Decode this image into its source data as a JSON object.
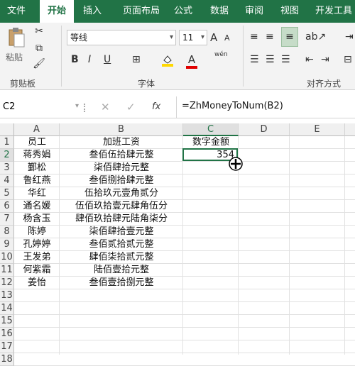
{
  "tabs": [
    "文件",
    "开始",
    "插入",
    "页面布局",
    "公式",
    "数据",
    "审阅",
    "视图",
    "开发工具"
  ],
  "ribbon": {
    "clipboard": {
      "paste_label": "粘贴",
      "group_label": "剪贴板"
    },
    "font": {
      "font_name": "等线",
      "font_size": "11",
      "group_label": "字体",
      "bold": "B",
      "italic": "I",
      "underline": "U",
      "grow": "A",
      "shrink": "A",
      "phonetic": "wén"
    },
    "alignment": {
      "group_label": "对齐方式"
    }
  },
  "formula_bar": {
    "name_box": "C2",
    "fx": "fx",
    "formula": "=ZhMoneyToNum(B2)"
  },
  "columns": [
    "A",
    "B",
    "C",
    "D",
    "E"
  ],
  "rows": [
    "1",
    "2",
    "3",
    "4",
    "5",
    "6",
    "7",
    "8",
    "9",
    "10",
    "11",
    "12",
    "13",
    "14",
    "15",
    "16",
    "17",
    "18"
  ],
  "data": [
    [
      "员工",
      "加班工资",
      "数字金额"
    ],
    [
      "蒋秀娟",
      "叁佰伍拾肆元整",
      "354"
    ],
    [
      "鄞松",
      "柒佰肆拾元整",
      ""
    ],
    [
      "鲁红燕",
      "叁佰捌拾肆元整",
      ""
    ],
    [
      "华红",
      "伍拾玖元壹角贰分",
      ""
    ],
    [
      "通名媛",
      "伍佰玖拾壹元肆角伍分",
      ""
    ],
    [
      "杨含玉",
      "肆佰玖拾肆元陆角柒分",
      ""
    ],
    [
      "陈婷",
      "柒佰肆拾壹元整",
      ""
    ],
    [
      "孔婷婷",
      "叁佰贰拾贰元整",
      ""
    ],
    [
      "王发弟",
      "肆佰柒拾贰元整",
      ""
    ],
    [
      "何紫霜",
      "陆佰壹拾元整",
      ""
    ],
    [
      "姜怡",
      "叁佰壹拾捌元整",
      ""
    ]
  ],
  "selected_cell": "C2",
  "colors": {
    "accent": "#217346",
    "fill_color": "#ffd800",
    "font_color": "#e00000"
  }
}
